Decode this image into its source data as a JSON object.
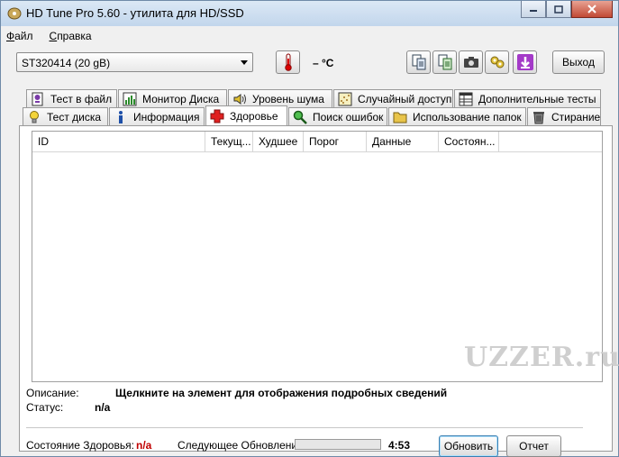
{
  "window": {
    "title": "HD Tune Pro 5.60 - утилита для HD/SSD"
  },
  "menu": [
    "Файл",
    "Справка"
  ],
  "toolbar": {
    "drive": "ST320414 (20 gB)",
    "temperature": "– °C",
    "exit_label": "Выход"
  },
  "tabs_row1": [
    "Тест в файл",
    "Монитор Диска",
    "Уровень шума",
    "Случайный доступ",
    "Дополнительные  тесты"
  ],
  "tabs_row2": [
    "Тест диска",
    "Информация",
    "Здоровье",
    "Поиск ошибок",
    "Использование папок",
    "Стирание"
  ],
  "active_tab": "Здоровье",
  "table": {
    "columns": [
      "ID",
      "Текущ...",
      "Худшее",
      "Порог",
      "Данные",
      "Состоян..."
    ],
    "rows": []
  },
  "watermark": "UZZER.ru",
  "details": {
    "description_label": "Описание:",
    "description_value": "Щелкните на элемент для отображения подробных сведений",
    "status_label": "Статус:",
    "status_value": "n/a"
  },
  "footer": {
    "health_label": "Состояние Здоровья:",
    "health_value": "n/a",
    "next_update_label": "Следующее Обновление:",
    "progress": 0,
    "time": "4:53",
    "refresh_label": "Обновить",
    "report_label": "Отчет"
  },
  "colors": {
    "health_value": "#c00000"
  }
}
